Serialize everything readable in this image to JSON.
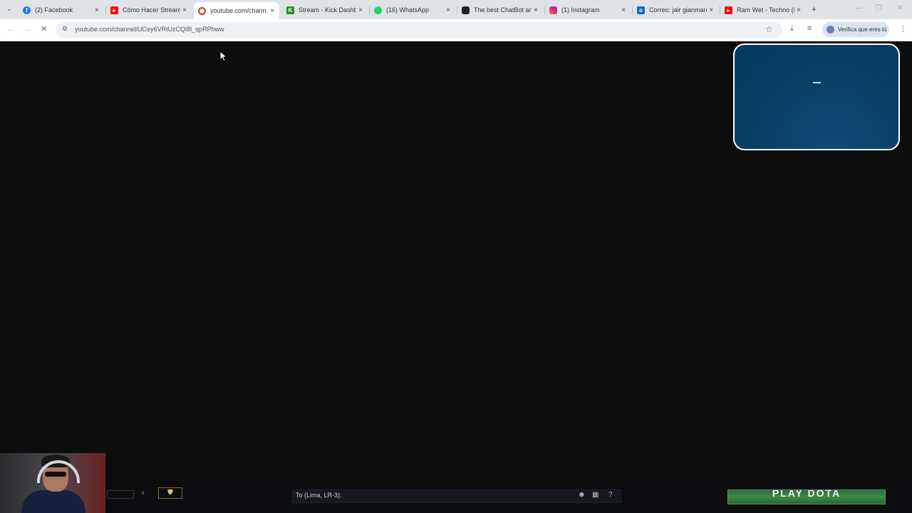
{
  "browser": {
    "tabs": [
      {
        "label": "(2) Facebook",
        "icon": "facebook-icon",
        "color": "#1877f2"
      },
      {
        "label": "Cómo Hacer Stream:",
        "icon": "youtube-icon",
        "color": "#ff0000"
      },
      {
        "label": "youtube.com/chann",
        "icon": "loading-icon",
        "color": "#d93025"
      },
      {
        "label": "Stream - Kick Dashbo",
        "icon": "kick-icon",
        "color": "#1f8f1f"
      },
      {
        "label": "(16) WhatsApp",
        "icon": "whatsapp-icon",
        "color": "#25d366"
      },
      {
        "label": "The best ChatBot an",
        "icon": "chatbot-icon",
        "color": "#222222"
      },
      {
        "label": "(1) Instagram",
        "icon": "instagram-icon",
        "color": "#c13584"
      },
      {
        "label": "Correo: jair gianmarc",
        "icon": "outlook-icon",
        "color": "#0f6cbd"
      },
      {
        "label": "Ram Wet - Techno (Re",
        "icon": "youtube-icon",
        "color": "#ff0000"
      }
    ],
    "tab_close_glyph": "×",
    "new_tab_glyph": "+",
    "url": "youtube.com/channel/UCey6VRtUzCQi8l_qpRPhww",
    "profile_chip_label": "Verifica que eres tú"
  },
  "stream_overlay": {
    "chat_label": "To (Lima, LR-3):",
    "play_button_label": "PLAY DOTA",
    "help_glyph": "?"
  }
}
